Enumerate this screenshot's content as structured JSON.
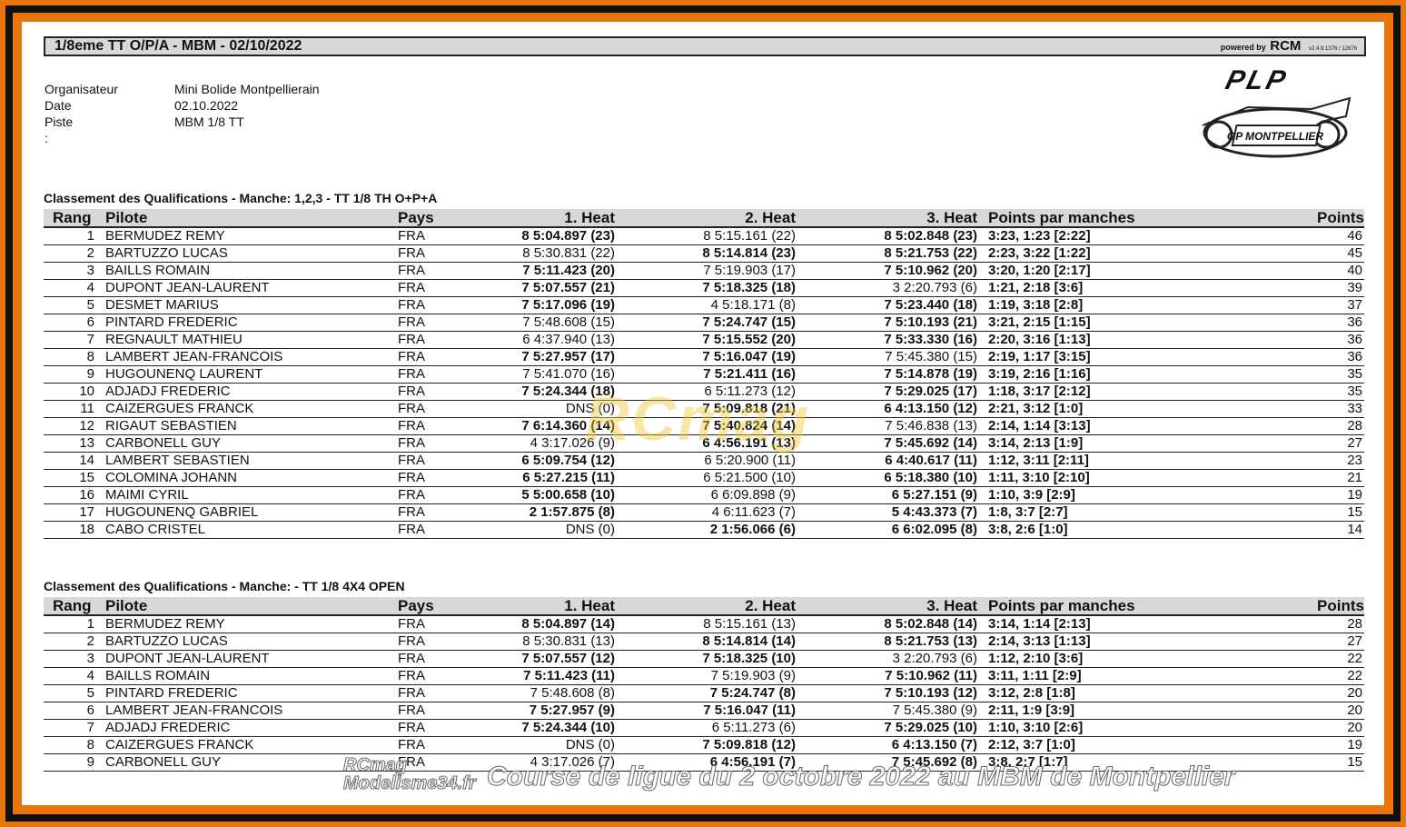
{
  "header": {
    "title": "1/8eme TT O/P/A - MBM - 02/10/2022",
    "powered_by": "powered by",
    "powered_brand": "RCM",
    "version": "v2.4.9.1376 / 12676"
  },
  "info": {
    "organisateur_label": "Organisateur :",
    "organisateur_value": "Mini Bolide Montpellierain",
    "date_label": "Date :",
    "date_value": "02.10.2022",
    "piste_label": "Piste :",
    "piste_value": "MBM 1/8 TT"
  },
  "logo": {
    "plp": "PLP",
    "gp": "GP MONTPELLIER"
  },
  "columns": {
    "rang": "Rang",
    "pilote": "Pilote",
    "pays": "Pays",
    "heat1": "1. Heat",
    "heat2": "2. Heat",
    "heat3": "3. Heat",
    "points_manches": "Points par manches",
    "points": "Points"
  },
  "section1": {
    "title": "Classement des Qualifications  -  Manche: 1,2,3  -  TT 1/8 TH O+P+A",
    "rows": [
      {
        "rang": "1",
        "pilote": "BERMUDEZ REMY",
        "pays": "FRA",
        "h1": "8 5:04.897 (23)",
        "h1b": true,
        "h2": "8 5:15.161 (22)",
        "h2b": false,
        "h3": "8 5:02.848 (23)",
        "h3b": true,
        "pm": "3:23, 1:23 [2:22]",
        "pts": "46"
      },
      {
        "rang": "2",
        "pilote": "BARTUZZO LUCAS",
        "pays": "FRA",
        "h1": "8 5:30.831 (22)",
        "h1b": false,
        "h2": "8 5:14.814 (23)",
        "h2b": true,
        "h3": "8 5:21.753 (22)",
        "h3b": true,
        "pm": "2:23, 3:22 [1:22]",
        "pts": "45"
      },
      {
        "rang": "3",
        "pilote": "BAILLS ROMAIN",
        "pays": "FRA",
        "h1": "7 5:11.423 (20)",
        "h1b": true,
        "h2": "7 5:19.903 (17)",
        "h2b": false,
        "h3": "7 5:10.962 (20)",
        "h3b": true,
        "pm": "3:20, 1:20 [2:17]",
        "pts": "40"
      },
      {
        "rang": "4",
        "pilote": "DUPONT JEAN-LAURENT",
        "pays": "FRA",
        "h1": "7 5:07.557 (21)",
        "h1b": true,
        "h2": "7 5:18.325 (18)",
        "h2b": true,
        "h3": "3 2:20.793 (6)",
        "h3b": false,
        "pm": "1:21, 2:18 [3:6]",
        "pts": "39"
      },
      {
        "rang": "5",
        "pilote": "DESMET MARIUS",
        "pays": "FRA",
        "h1": "7 5:17.096 (19)",
        "h1b": true,
        "h2": "4 5:18.171 (8)",
        "h2b": false,
        "h3": "7 5:23.440 (18)",
        "h3b": true,
        "pm": "1:19, 3:18 [2:8]",
        "pts": "37"
      },
      {
        "rang": "6",
        "pilote": "PINTARD FREDERIC",
        "pays": "FRA",
        "h1": "7 5:48.608 (15)",
        "h1b": false,
        "h2": "7 5:24.747 (15)",
        "h2b": true,
        "h3": "7 5:10.193 (21)",
        "h3b": true,
        "pm": "3:21, 2:15 [1:15]",
        "pts": "36"
      },
      {
        "rang": "7",
        "pilote": "REGNAULT MATHIEU",
        "pays": "FRA",
        "h1": "6 4:37.940 (13)",
        "h1b": false,
        "h2": "7 5:15.552 (20)",
        "h2b": true,
        "h3": "7 5:33.330 (16)",
        "h3b": true,
        "pm": "2:20, 3:16 [1:13]",
        "pts": "36"
      },
      {
        "rang": "8",
        "pilote": "LAMBERT JEAN-FRANCOIS",
        "pays": "FRA",
        "h1": "7 5:27.957 (17)",
        "h1b": true,
        "h2": "7 5:16.047 (19)",
        "h2b": true,
        "h3": "7 5:45.380 (15)",
        "h3b": false,
        "pm": "2:19, 1:17 [3:15]",
        "pts": "36"
      },
      {
        "rang": "9",
        "pilote": "HUGOUNENQ LAURENT",
        "pays": "FRA",
        "h1": "7 5:41.070 (16)",
        "h1b": false,
        "h2": "7 5:21.411 (16)",
        "h2b": true,
        "h3": "7 5:14.878 (19)",
        "h3b": true,
        "pm": "3:19, 2:16 [1:16]",
        "pts": "35"
      },
      {
        "rang": "10",
        "pilote": "ADJADJ FREDERIC",
        "pays": "FRA",
        "h1": "7 5:24.344 (18)",
        "h1b": true,
        "h2": "6 5:11.273 (12)",
        "h2b": false,
        "h3": "7 5:29.025 (17)",
        "h3b": true,
        "pm": "1:18, 3:17 [2:12]",
        "pts": "35"
      },
      {
        "rang": "11",
        "pilote": "CAIZERGUES FRANCK",
        "pays": "FRA",
        "h1": "DNS (0)",
        "h1b": false,
        "h2": "7 5:09.818 (21)",
        "h2b": true,
        "h3": "6 4:13.150 (12)",
        "h3b": true,
        "pm": "2:21, 3:12 [1:0]",
        "pts": "33"
      },
      {
        "rang": "12",
        "pilote": "RIGAUT SEBASTIEN",
        "pays": "FRA",
        "h1": "7 6:14.360 (14)",
        "h1b": true,
        "h2": "7 5:40.824 (14)",
        "h2b": true,
        "h3": "7 5:46.838 (13)",
        "h3b": false,
        "pm": "2:14, 1:14 [3:13]",
        "pts": "28"
      },
      {
        "rang": "13",
        "pilote": "CARBONELL GUY",
        "pays": "FRA",
        "h1": "4 3:17.026 (9)",
        "h1b": false,
        "h2": "6 4:56.191 (13)",
        "h2b": true,
        "h3": "7 5:45.692 (14)",
        "h3b": true,
        "pm": "3:14, 2:13 [1:9]",
        "pts": "27"
      },
      {
        "rang": "14",
        "pilote": "LAMBERT SEBASTIEN",
        "pays": "FRA",
        "h1": "6 5:09.754 (12)",
        "h1b": true,
        "h2": "6 5:20.900 (11)",
        "h2b": false,
        "h3": "6 4:40.617 (11)",
        "h3b": true,
        "pm": "1:12, 3:11 [2:11]",
        "pts": "23"
      },
      {
        "rang": "15",
        "pilote": "COLOMINA JOHANN",
        "pays": "FRA",
        "h1": "6 5:27.215 (11)",
        "h1b": true,
        "h2": "6 5:21.500 (10)",
        "h2b": false,
        "h3": "6 5:18.380 (10)",
        "h3b": true,
        "pm": "1:11, 3:10 [2:10]",
        "pts": "21"
      },
      {
        "rang": "16",
        "pilote": "MAIMI CYRIL",
        "pays": "FRA",
        "h1": "5 5:00.658 (10)",
        "h1b": true,
        "h2": "6 6:09.898 (9)",
        "h2b": false,
        "h3": "6 5:27.151 (9)",
        "h3b": true,
        "pm": "1:10, 3:9 [2:9]",
        "pts": "19"
      },
      {
        "rang": "17",
        "pilote": "HUGOUNENQ GABRIEL",
        "pays": "FRA",
        "h1": "2 1:57.875 (8)",
        "h1b": true,
        "h2": "4 6:11.623 (7)",
        "h2b": false,
        "h3": "5 4:43.373 (7)",
        "h3b": true,
        "pm": "1:8, 3:7 [2:7]",
        "pts": "15"
      },
      {
        "rang": "18",
        "pilote": "CABO CRISTEL",
        "pays": "FRA",
        "h1": "DNS (0)",
        "h1b": false,
        "h2": "2 1:56.066 (6)",
        "h2b": true,
        "h3": "6 6:02.095 (8)",
        "h3b": true,
        "pm": "3:8, 2:6 [1:0]",
        "pts": "14"
      }
    ]
  },
  "section2": {
    "title": "Classement des Qualifications  -  Manche:   -  TT 1/8 4X4 OPEN",
    "rows": [
      {
        "rang": "1",
        "pilote": "BERMUDEZ REMY",
        "pays": "FRA",
        "h1": "8 5:04.897 (14)",
        "h1b": true,
        "h2": "8 5:15.161 (13)",
        "h2b": false,
        "h3": "8 5:02.848 (14)",
        "h3b": true,
        "pm": "3:14, 1:14 [2:13]",
        "pts": "28"
      },
      {
        "rang": "2",
        "pilote": "BARTUZZO LUCAS",
        "pays": "FRA",
        "h1": "8 5:30.831 (13)",
        "h1b": false,
        "h2": "8 5:14.814 (14)",
        "h2b": true,
        "h3": "8 5:21.753 (13)",
        "h3b": true,
        "pm": "2:14, 3:13 [1:13]",
        "pts": "27"
      },
      {
        "rang": "3",
        "pilote": "DUPONT JEAN-LAURENT",
        "pays": "FRA",
        "h1": "7 5:07.557 (12)",
        "h1b": true,
        "h2": "7 5:18.325 (10)",
        "h2b": true,
        "h3": "3 2:20.793 (6)",
        "h3b": false,
        "pm": "1:12, 2:10 [3:6]",
        "pts": "22"
      },
      {
        "rang": "4",
        "pilote": "BAILLS ROMAIN",
        "pays": "FRA",
        "h1": "7 5:11.423 (11)",
        "h1b": true,
        "h2": "7 5:19.903 (9)",
        "h2b": false,
        "h3": "7 5:10.962 (11)",
        "h3b": true,
        "pm": "3:11, 1:11 [2:9]",
        "pts": "22"
      },
      {
        "rang": "5",
        "pilote": "PINTARD FREDERIC",
        "pays": "FRA",
        "h1": "7 5:48.608 (8)",
        "h1b": false,
        "h2": "7 5:24.747 (8)",
        "h2b": true,
        "h3": "7 5:10.193 (12)",
        "h3b": true,
        "pm": "3:12, 2:8 [1:8]",
        "pts": "20"
      },
      {
        "rang": "6",
        "pilote": "LAMBERT JEAN-FRANCOIS",
        "pays": "FRA",
        "h1": "7 5:27.957 (9)",
        "h1b": true,
        "h2": "7 5:16.047 (11)",
        "h2b": true,
        "h3": "7 5:45.380 (9)",
        "h3b": false,
        "pm": "2:11, 1:9 [3:9]",
        "pts": "20"
      },
      {
        "rang": "7",
        "pilote": "ADJADJ FREDERIC",
        "pays": "FRA",
        "h1": "7 5:24.344 (10)",
        "h1b": true,
        "h2": "6 5:11.273 (6)",
        "h2b": false,
        "h3": "7 5:29.025 (10)",
        "h3b": true,
        "pm": "1:10, 3:10 [2:6]",
        "pts": "20"
      },
      {
        "rang": "8",
        "pilote": "CAIZERGUES FRANCK",
        "pays": "FRA",
        "h1": "DNS (0)",
        "h1b": false,
        "h2": "7 5:09.818 (12)",
        "h2b": true,
        "h3": "6 4:13.150 (7)",
        "h3b": true,
        "pm": "2:12, 3:7 [1:0]",
        "pts": "19"
      },
      {
        "rang": "9",
        "pilote": "CARBONELL GUY",
        "pays": "FRA",
        "h1": "4 3:17.026 (7)",
        "h1b": false,
        "h2": "6 4:56.191 (7)",
        "h2b": true,
        "h3": "7 5:45.692 (8)",
        "h3b": true,
        "pm": "3:8, 2:7 [1:7]",
        "pts": "15"
      }
    ]
  },
  "watermark": {
    "center": "RCmag",
    "bottom_left_1": "RCmag",
    "bottom_left_2": "Modelisme34.fr",
    "bottom": "Course de ligue du 2 octobre 2022 au MBM de Montpellier"
  }
}
